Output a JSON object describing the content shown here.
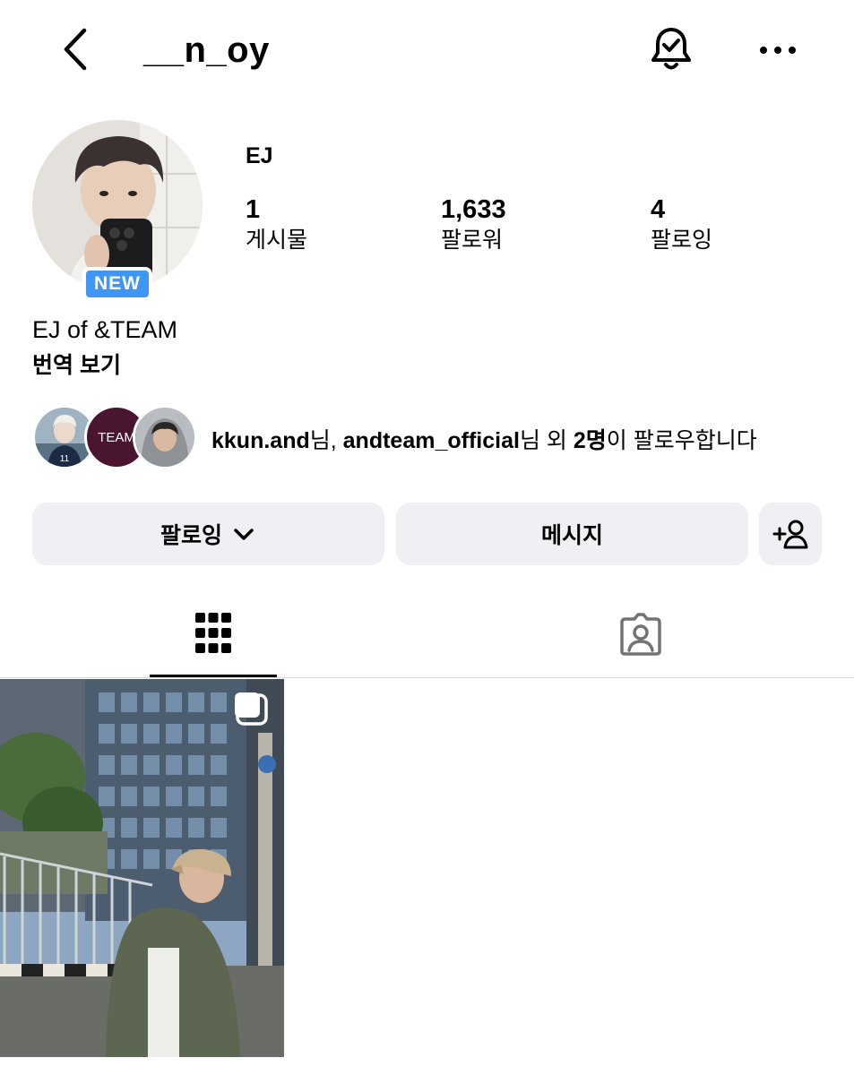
{
  "header": {
    "username": "__n_oy",
    "icons": {
      "back": "chevron-left-icon",
      "notifications": "bell-check-icon",
      "more": "more-horizontal-icon"
    }
  },
  "profile": {
    "new_badge": "NEW",
    "display_name": "EJ",
    "stats": [
      {
        "value": "1",
        "label": "게시물"
      },
      {
        "value": "1,633",
        "label": "팔로워"
      },
      {
        "value": "4",
        "label": "팔로잉"
      }
    ],
    "bio": "EJ of &TEAM",
    "translate_label": "번역 보기"
  },
  "mutual_followers": {
    "avatar_text": "TEAM",
    "user1": "kkun.and",
    "suffix1": "님, ",
    "user2": "andteam_official",
    "suffix2": "님 외 ",
    "count": "2명",
    "tail": "이 팔로우합니다"
  },
  "actions": {
    "following_label": "팔로잉",
    "message_label": "메시지",
    "icons": {
      "following_dropdown": "chevron-down-icon",
      "add_friend": "person-add-icon"
    }
  },
  "tabs": {
    "icons": {
      "grid": "grid-icon",
      "tagged": "tagged-person-icon"
    },
    "active": "grid"
  },
  "colors": {
    "badge_blue": "#3f96f4",
    "button_bg": "#eff0f3",
    "divider": "#dbdbdb",
    "team_avatar": "#4a1530"
  }
}
